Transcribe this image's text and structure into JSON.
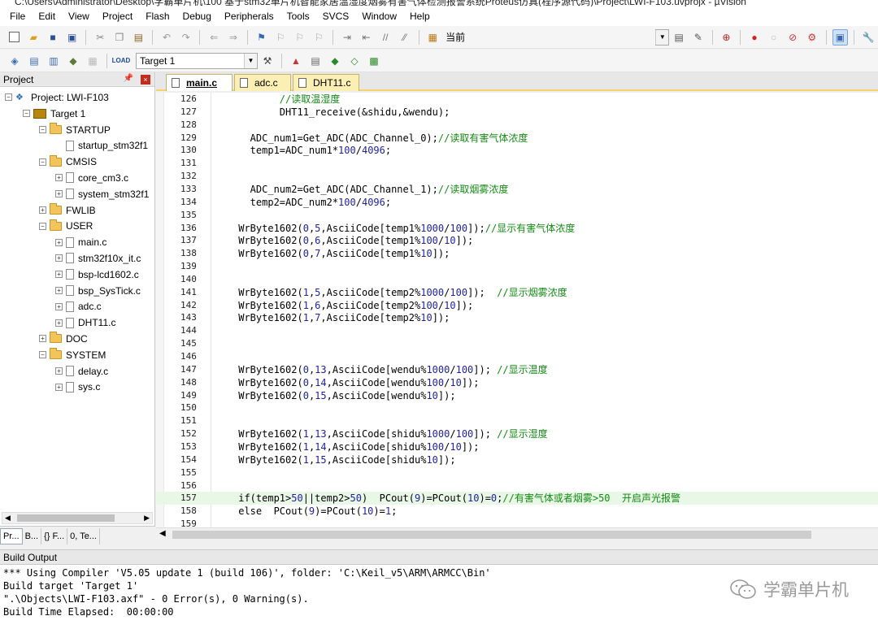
{
  "window": {
    "title": "C:\\Users\\Administrator\\Desktop\\学霸单片机\\100 基于stm32单片机智能家居温湿度烟雾有害气体检测报警系统Proteus仿真(程序源代码)\\Project\\LWI-F103.uvprojx - µVision"
  },
  "menu": [
    "File",
    "Edit",
    "View",
    "Project",
    "Flash",
    "Debug",
    "Peripherals",
    "Tools",
    "SVCS",
    "Window",
    "Help"
  ],
  "toolbar": {
    "find_value": "当前",
    "target_value": "Target 1",
    "load_label": "LOAD"
  },
  "project_panel": {
    "title": "Project",
    "pin": "ᵖ",
    "close": "×",
    "root": "Project: LWI-F103",
    "target": "Target 1",
    "tree": [
      {
        "type": "folder",
        "label": "STARTUP",
        "level": 2,
        "exp": "−"
      },
      {
        "type": "file",
        "label": "startup_stm32f1",
        "level": 3,
        "exp": ""
      },
      {
        "type": "folder",
        "label": "CMSIS",
        "level": 2,
        "exp": "−"
      },
      {
        "type": "file",
        "label": "core_cm3.c",
        "level": 3,
        "exp": "+"
      },
      {
        "type": "file",
        "label": "system_stm32f1",
        "level": 3,
        "exp": "+"
      },
      {
        "type": "folder",
        "label": "FWLIB",
        "level": 2,
        "exp": "+"
      },
      {
        "type": "folder",
        "label": "USER",
        "level": 2,
        "exp": "−"
      },
      {
        "type": "file",
        "label": "main.c",
        "level": 3,
        "exp": "+"
      },
      {
        "type": "file",
        "label": "stm32f10x_it.c",
        "level": 3,
        "exp": "+"
      },
      {
        "type": "file",
        "label": "bsp-lcd1602.c",
        "level": 3,
        "exp": "+"
      },
      {
        "type": "file",
        "label": "bsp_SysTick.c",
        "level": 3,
        "exp": "+"
      },
      {
        "type": "file",
        "label": "adc.c",
        "level": 3,
        "exp": "+"
      },
      {
        "type": "file",
        "label": "DHT11.c",
        "level": 3,
        "exp": "+"
      },
      {
        "type": "folder",
        "label": "DOC",
        "level": 2,
        "exp": "+"
      },
      {
        "type": "folder",
        "label": "SYSTEM",
        "level": 2,
        "exp": "−"
      },
      {
        "type": "file",
        "label": "delay.c",
        "level": 3,
        "exp": "+"
      },
      {
        "type": "file",
        "label": "sys.c",
        "level": 3,
        "exp": "+"
      }
    ],
    "bottom_tabs": [
      "Pr...",
      "B...",
      "{} F...",
      "0, Te..."
    ]
  },
  "editor": {
    "tabs": [
      "main.c",
      "adc.c",
      "DHT11.c"
    ],
    "active_tab": "main.c",
    "lines": [
      {
        "n": "126",
        "code": "        //读取温湿度",
        "hl": false
      },
      {
        "n": "127",
        "code": "        DHT11_receive(&shidu,&wendu);",
        "hl": false
      },
      {
        "n": "128",
        "code": "",
        "hl": false
      },
      {
        "n": "129",
        "code": "   ADC_num1=Get_ADC(ADC_Channel_0);//读取有害气体浓度",
        "hl": false
      },
      {
        "n": "130",
        "code": "   temp1=ADC_num1*100/4096;",
        "hl": false
      },
      {
        "n": "131",
        "code": "",
        "hl": false
      },
      {
        "n": "132",
        "code": "",
        "hl": false
      },
      {
        "n": "133",
        "code": "   ADC_num2=Get_ADC(ADC_Channel_1);//读取烟雾浓度",
        "hl": false
      },
      {
        "n": "134",
        "code": "   temp2=ADC_num2*100/4096;",
        "hl": false
      },
      {
        "n": "135",
        "code": "",
        "hl": false
      },
      {
        "n": "136",
        "code": " WrByte1602(0,5,AsciiCode[temp1%1000/100]);//显示有害气体浓度",
        "hl": false
      },
      {
        "n": "137",
        "code": " WrByte1602(0,6,AsciiCode[temp1%100/10]);",
        "hl": false
      },
      {
        "n": "138",
        "code": " WrByte1602(0,7,AsciiCode[temp1%10]);",
        "hl": false
      },
      {
        "n": "139",
        "code": "",
        "hl": false
      },
      {
        "n": "140",
        "code": "",
        "hl": false
      },
      {
        "n": "141",
        "code": " WrByte1602(1,5,AsciiCode[temp2%1000/100]);  //显示烟雾浓度",
        "hl": false
      },
      {
        "n": "142",
        "code": " WrByte1602(1,6,AsciiCode[temp2%100/10]);",
        "hl": false
      },
      {
        "n": "143",
        "code": " WrByte1602(1,7,AsciiCode[temp2%10]);",
        "hl": false
      },
      {
        "n": "144",
        "code": "",
        "hl": false
      },
      {
        "n": "145",
        "code": "",
        "hl": false
      },
      {
        "n": "146",
        "code": "",
        "hl": false
      },
      {
        "n": "147",
        "code": " WrByte1602(0,13,AsciiCode[wendu%1000/100]); //显示温度",
        "hl": false
      },
      {
        "n": "148",
        "code": " WrByte1602(0,14,AsciiCode[wendu%100/10]);",
        "hl": false
      },
      {
        "n": "149",
        "code": " WrByte1602(0,15,AsciiCode[wendu%10]);",
        "hl": false
      },
      {
        "n": "150",
        "code": "",
        "hl": false
      },
      {
        "n": "151",
        "code": "",
        "hl": false
      },
      {
        "n": "152",
        "code": " WrByte1602(1,13,AsciiCode[shidu%1000/100]); //显示湿度",
        "hl": false
      },
      {
        "n": "153",
        "code": " WrByte1602(1,14,AsciiCode[shidu%100/10]);",
        "hl": false
      },
      {
        "n": "154",
        "code": " WrByte1602(1,15,AsciiCode[shidu%10]);",
        "hl": false
      },
      {
        "n": "155",
        "code": "",
        "hl": false
      },
      {
        "n": "156",
        "code": "",
        "hl": false
      },
      {
        "n": "157",
        "code": " if(temp1>50||temp2>50)  PCout(9)=PCout(10)=0;//有害气体或者烟雾>50  开启声光报警",
        "hl": true
      },
      {
        "n": "158",
        "code": " else  PCout(9)=PCout(10)=1;",
        "hl": false
      },
      {
        "n": "159",
        "code": "",
        "hl": false
      }
    ]
  },
  "build_output": {
    "title": "Build Output",
    "lines": [
      "*** Using Compiler 'V5.05 update 1 (build 106)', folder: 'C:\\Keil_v5\\ARM\\ARMCC\\Bin'",
      "Build target 'Target 1'",
      "\".\\Objects\\LWI-F103.axf\" - 0 Error(s), 0 Warning(s).",
      "Build Time Elapsed:  00:00:00"
    ]
  },
  "watermark": {
    "text": "学霸单片机"
  },
  "colors": {
    "comment": "#138a13",
    "highlight": "#e8f7e6",
    "tab_active": "#ffffff",
    "tab_inactive": "#fcefb3"
  }
}
